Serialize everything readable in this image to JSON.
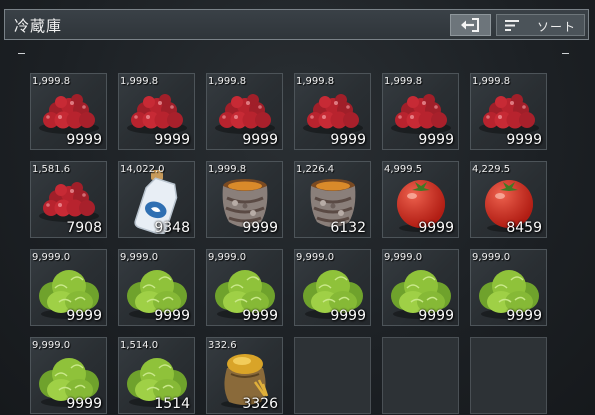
{
  "header": {
    "title": "冷蔵庫",
    "sort_label": "ソート"
  },
  "slots": [
    {
      "item": "berries",
      "weight": "1,999.8",
      "qty": "9999"
    },
    {
      "item": "berries",
      "weight": "1,999.8",
      "qty": "9999"
    },
    {
      "item": "berries",
      "weight": "1,999.8",
      "qty": "9999"
    },
    {
      "item": "berries",
      "weight": "1,999.8",
      "qty": "9999"
    },
    {
      "item": "berries",
      "weight": "1,999.8",
      "qty": "9999"
    },
    {
      "item": "berries",
      "weight": "1,999.8",
      "qty": "9999"
    },
    {
      "item": "berries",
      "weight": "1,581.6",
      "qty": "7908"
    },
    {
      "item": "milk-bottle",
      "weight": "14,022.0",
      "qty": "9348"
    },
    {
      "item": "jar",
      "weight": "1,999.8",
      "qty": "9999"
    },
    {
      "item": "jar",
      "weight": "1,226.4",
      "qty": "6132"
    },
    {
      "item": "tomato",
      "weight": "4,999.5",
      "qty": "9999"
    },
    {
      "item": "tomato",
      "weight": "4,229.5",
      "qty": "8459"
    },
    {
      "item": "lettuce",
      "weight": "9,999.0",
      "qty": "9999"
    },
    {
      "item": "lettuce",
      "weight": "9,999.0",
      "qty": "9999"
    },
    {
      "item": "lettuce",
      "weight": "9,999.0",
      "qty": "9999"
    },
    {
      "item": "lettuce",
      "weight": "9,999.0",
      "qty": "9999"
    },
    {
      "item": "lettuce",
      "weight": "9,999.0",
      "qty": "9999"
    },
    {
      "item": "lettuce",
      "weight": "9,999.0",
      "qty": "9999"
    },
    {
      "item": "lettuce",
      "weight": "9,999.0",
      "qty": "9999"
    },
    {
      "item": "lettuce",
      "weight": "1,514.0",
      "qty": "1514"
    },
    {
      "item": "flour-sack",
      "weight": "332.6",
      "qty": "3326"
    },
    {
      "item": "empty",
      "weight": "",
      "qty": ""
    },
    {
      "item": "empty",
      "weight": "",
      "qty": ""
    },
    {
      "item": "empty",
      "weight": "",
      "qty": ""
    }
  ],
  "icons": {
    "exit": "exit-icon",
    "sort": "sort-icon"
  },
  "colors": {
    "berry": "#b8232e",
    "tomato": "#d8291f",
    "lettuce": "#8fc23a",
    "milk": "#e8eef5",
    "flour": "#d9a428"
  }
}
